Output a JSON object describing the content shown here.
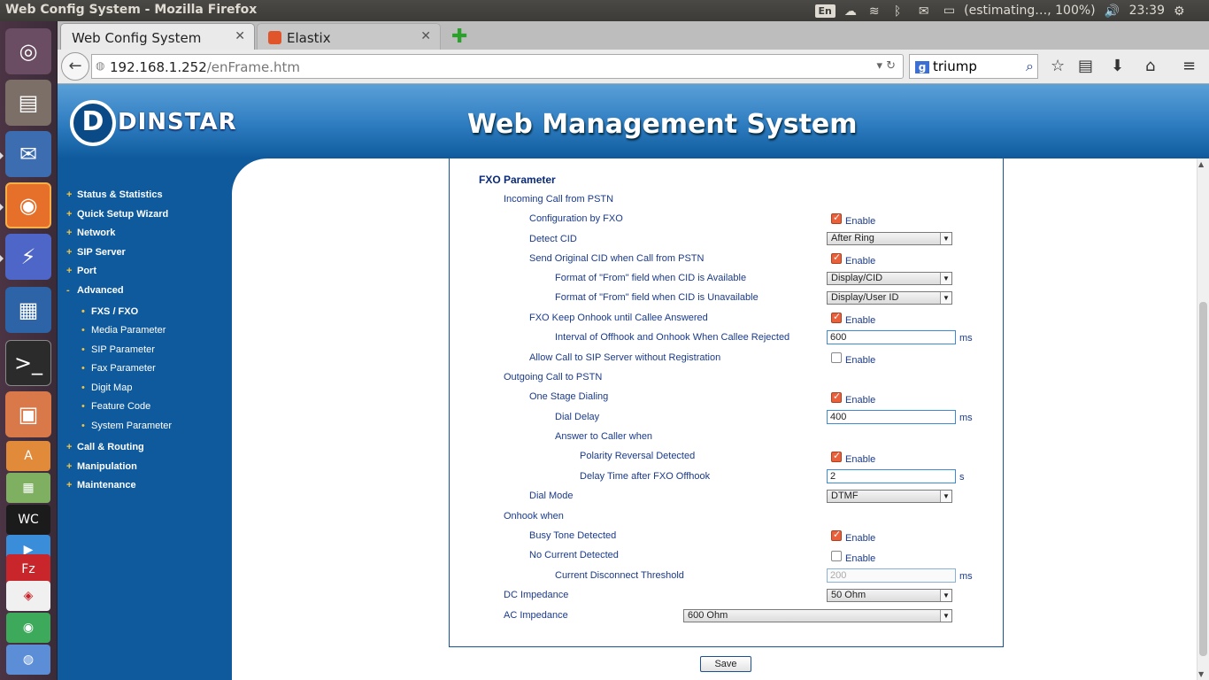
{
  "os": {
    "window_title": "Web Config System - Mozilla Firefox",
    "lang": "En",
    "battery": "(estimating…, 100%)",
    "clock": "23:39"
  },
  "browser": {
    "tabs": [
      {
        "label": "Web Config System",
        "active": true
      },
      {
        "label": "Elastix",
        "active": false
      }
    ],
    "url_host": "192.168.1.252",
    "url_path": "/enFrame.htm",
    "search_value": "triump"
  },
  "header": {
    "logo_letter": "D",
    "brand": "DINSTAR",
    "title": "Web Management System"
  },
  "nav": {
    "items": [
      {
        "label": "Status & Statistics",
        "bullet": "+"
      },
      {
        "label": "Quick Setup Wizard",
        "bullet": "+"
      },
      {
        "label": "Network",
        "bullet": "+"
      },
      {
        "label": "SIP Server",
        "bullet": "+"
      },
      {
        "label": "Port",
        "bullet": "+"
      },
      {
        "label": "Advanced",
        "bullet": "-"
      },
      {
        "label": "Call & Routing",
        "bullet": "+"
      },
      {
        "label": "Manipulation",
        "bullet": "+"
      },
      {
        "label": "Maintenance",
        "bullet": "+"
      }
    ],
    "sub": [
      {
        "label": "FXS / FXO"
      },
      {
        "label": "Media Parameter"
      },
      {
        "label": "SIP Parameter"
      },
      {
        "label": "Fax Parameter"
      },
      {
        "label": "Digit Map"
      },
      {
        "label": "Feature Code"
      },
      {
        "label": "System Parameter"
      }
    ]
  },
  "form": {
    "title": "FXO Parameter",
    "enable_label": "Enable",
    "rows": {
      "incoming": "Incoming Call from PSTN",
      "config_fxo": "Configuration by FXO",
      "detect_cid": "Detect CID",
      "detect_cid_value": "After Ring",
      "send_cid": "Send Original CID when Call from PSTN",
      "from_avail": "Format of \"From\" field when CID is Available",
      "from_avail_value": "Display/CID",
      "from_unavail": "Format of \"From\" field when CID is Unavailable",
      "from_unavail_value": "Display/User ID",
      "keep_onhook": "FXO Keep Onhook until Callee Answered",
      "interval": "Interval of Offhook and Onhook When Callee Rejected",
      "interval_value": "600",
      "allow_call": "Allow Call to SIP Server without Registration",
      "outgoing": "Outgoing Call to PSTN",
      "one_stage": "One Stage Dialing",
      "dial_delay": "Dial Delay",
      "dial_delay_value": "400",
      "answer_when": "Answer to Caller when",
      "polarity": "Polarity Reversal Detected",
      "delay_offhook": "Delay Time after FXO Offhook",
      "delay_offhook_value": "2",
      "dial_mode": "Dial Mode",
      "dial_mode_value": "DTMF",
      "onhook_when": "Onhook when",
      "busy_tone": "Busy Tone Detected",
      "no_current": "No Current Detected",
      "current_threshold": "Current Disconnect Threshold",
      "current_threshold_value": "200",
      "dc_imp": "DC Impedance",
      "dc_imp_value": "50 Ohm",
      "ac_imp": "AC Impedance",
      "ac_imp_value": "600 Ohm"
    },
    "units": {
      "ms": "ms",
      "s": "s"
    },
    "save_label": "Save"
  }
}
